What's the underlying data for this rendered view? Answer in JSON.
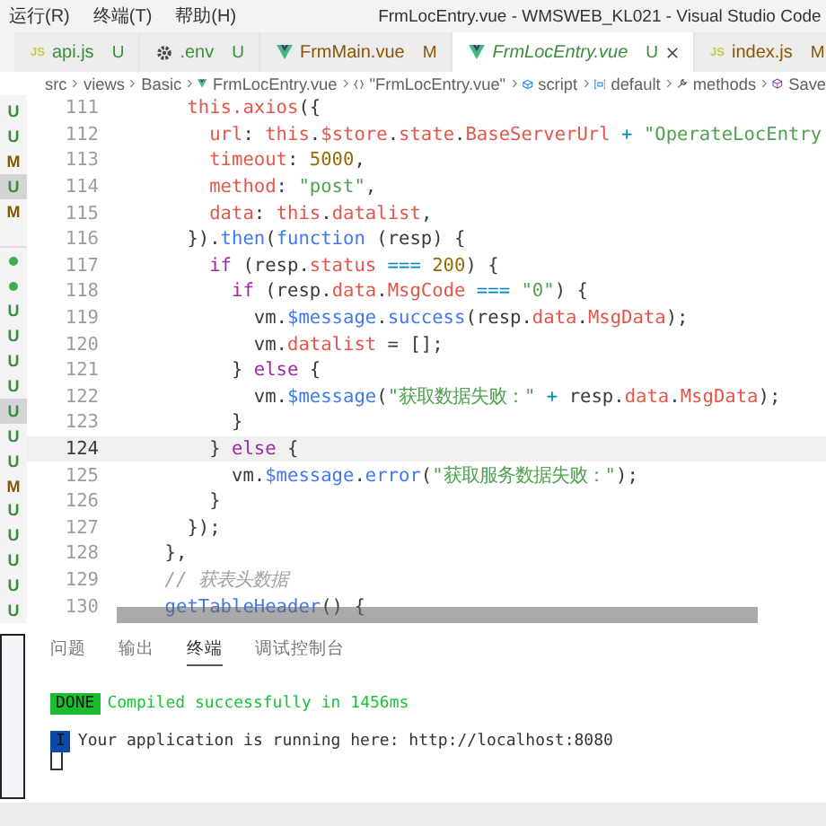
{
  "menu": {
    "items": [
      "运行(R)",
      "终端(T)",
      "帮助(H)"
    ]
  },
  "window": {
    "title": "FrmLocEntry.vue - WMSWEB_KL021 - Visual Studio Code"
  },
  "tabs": [
    {
      "label": "api.js",
      "kind": "js",
      "icon_label": "JS",
      "status": "U",
      "selected": false
    },
    {
      "label": ".env",
      "kind": "gear",
      "status": "U",
      "selected": false
    },
    {
      "label": "FrmMain.vue",
      "kind": "vue",
      "status": "M",
      "selected": false
    },
    {
      "label": "FrmLocEntry.vue",
      "kind": "vue",
      "status": "U",
      "selected": true
    },
    {
      "label": "index.js",
      "kind": "js",
      "icon_label": "JS",
      "status": "M",
      "selected": false
    }
  ],
  "breadcrumb": [
    {
      "label": "src",
      "kind": "plain"
    },
    {
      "label": "views",
      "kind": "plain"
    },
    {
      "label": "Basic",
      "kind": "plain"
    },
    {
      "label": "FrmLocEntry.vue",
      "kind": "vue"
    },
    {
      "label": "\"FrmLocEntry.vue\"",
      "kind": "braces"
    },
    {
      "label": "script",
      "kind": "cube"
    },
    {
      "label": "default",
      "kind": "variable"
    },
    {
      "label": "methods",
      "kind": "wrench"
    },
    {
      "label": "Save",
      "kind": "box"
    }
  ],
  "explorer_decorations": [
    {
      "kind": "letter",
      "text": "U",
      "selected": false
    },
    {
      "kind": "letter",
      "text": "U",
      "selected": false
    },
    {
      "kind": "letter",
      "text": "M",
      "selected": false
    },
    {
      "kind": "letter",
      "text": "U",
      "selected": true
    },
    {
      "kind": "letter",
      "text": "M",
      "selected": false
    },
    {
      "kind": "separator"
    },
    {
      "kind": "dot"
    },
    {
      "kind": "dot"
    },
    {
      "kind": "letter",
      "text": "U",
      "selected": false
    },
    {
      "kind": "letter",
      "text": "U",
      "selected": false
    },
    {
      "kind": "letter",
      "text": "U",
      "selected": false
    },
    {
      "kind": "letter",
      "text": "U",
      "selected": false
    },
    {
      "kind": "letter",
      "text": "U",
      "selected": true
    },
    {
      "kind": "letter",
      "text": "U",
      "selected": false
    },
    {
      "kind": "letter",
      "text": "U",
      "selected": false
    },
    {
      "kind": "letter",
      "text": "M",
      "selected": false
    },
    {
      "kind": "letter",
      "text": "U",
      "selected": false
    },
    {
      "kind": "letter",
      "text": "U",
      "selected": false
    },
    {
      "kind": "letter",
      "text": "U",
      "selected": false
    },
    {
      "kind": "letter",
      "text": "U",
      "selected": false
    },
    {
      "kind": "letter",
      "text": "U",
      "selected": false
    }
  ],
  "code": [
    {
      "number": "111",
      "current": false,
      "tokens": [
        {
          "kind": "var",
          "text": "      this.axios"
        },
        {
          "kind": "p",
          "text": "({"
        }
      ]
    },
    {
      "number": "112",
      "current": false,
      "tokens": [
        {
          "kind": "var",
          "text": "        url"
        },
        {
          "kind": "p",
          "text": ": "
        },
        {
          "kind": "var",
          "text": "this"
        },
        {
          "kind": "p",
          "text": "."
        },
        {
          "kind": "var",
          "text": "$store"
        },
        {
          "kind": "p",
          "text": "."
        },
        {
          "kind": "var",
          "text": "state"
        },
        {
          "kind": "p",
          "text": "."
        },
        {
          "kind": "var",
          "text": "BaseServerUrl"
        },
        {
          "kind": "op",
          "text": " + "
        },
        {
          "kind": "str",
          "text": "\"OperateLocEntry"
        }
      ]
    },
    {
      "number": "113",
      "current": false,
      "tokens": [
        {
          "kind": "var",
          "text": "        timeout"
        },
        {
          "kind": "p",
          "text": ": "
        },
        {
          "kind": "num",
          "text": "5000"
        },
        {
          "kind": "p",
          "text": ","
        }
      ]
    },
    {
      "number": "114",
      "current": false,
      "tokens": [
        {
          "kind": "var",
          "text": "        method"
        },
        {
          "kind": "p",
          "text": ": "
        },
        {
          "kind": "str",
          "text": "\"post\""
        },
        {
          "kind": "p",
          "text": ","
        }
      ]
    },
    {
      "number": "115",
      "current": false,
      "tokens": [
        {
          "kind": "var",
          "text": "        data"
        },
        {
          "kind": "p",
          "text": ": "
        },
        {
          "kind": "var",
          "text": "this"
        },
        {
          "kind": "p",
          "text": "."
        },
        {
          "kind": "var",
          "text": "datalist"
        },
        {
          "kind": "p",
          "text": ","
        }
      ]
    },
    {
      "number": "116",
      "current": false,
      "tokens": [
        {
          "kind": "p",
          "text": "      })."
        },
        {
          "kind": "fn",
          "text": "then"
        },
        {
          "kind": "p",
          "text": "("
        },
        {
          "kind": "fn",
          "text": "function"
        },
        {
          "kind": "p",
          "text": " (resp) {"
        }
      ]
    },
    {
      "number": "117",
      "current": false,
      "tokens": [
        {
          "kind": "kw",
          "text": "        if"
        },
        {
          "kind": "p",
          "text": " (resp."
        },
        {
          "kind": "var",
          "text": "status"
        },
        {
          "kind": "op",
          "text": " === "
        },
        {
          "kind": "num",
          "text": "200"
        },
        {
          "kind": "p",
          "text": ") {"
        }
      ]
    },
    {
      "number": "118",
      "current": false,
      "tokens": [
        {
          "kind": "kw",
          "text": "          if"
        },
        {
          "kind": "p",
          "text": " (resp."
        },
        {
          "kind": "var",
          "text": "data"
        },
        {
          "kind": "p",
          "text": "."
        },
        {
          "kind": "var",
          "text": "MsgCode"
        },
        {
          "kind": "op",
          "text": " === "
        },
        {
          "kind": "str",
          "text": "\"0\""
        },
        {
          "kind": "p",
          "text": ") {"
        }
      ]
    },
    {
      "number": "119",
      "current": false,
      "tokens": [
        {
          "kind": "p",
          "text": "            vm."
        },
        {
          "kind": "fn",
          "text": "$message"
        },
        {
          "kind": "p",
          "text": "."
        },
        {
          "kind": "fn",
          "text": "success"
        },
        {
          "kind": "p",
          "text": "(resp."
        },
        {
          "kind": "var",
          "text": "data"
        },
        {
          "kind": "p",
          "text": "."
        },
        {
          "kind": "var",
          "text": "MsgData"
        },
        {
          "kind": "p",
          "text": ");"
        }
      ]
    },
    {
      "number": "120",
      "current": false,
      "tokens": [
        {
          "kind": "p",
          "text": "            vm."
        },
        {
          "kind": "var",
          "text": "datalist"
        },
        {
          "kind": "p",
          "text": " = [];"
        }
      ]
    },
    {
      "number": "121",
      "current": false,
      "tokens": [
        {
          "kind": "p",
          "text": "          } "
        },
        {
          "kind": "kw",
          "text": "else"
        },
        {
          "kind": "p",
          "text": " {"
        }
      ]
    },
    {
      "number": "122",
      "current": false,
      "tokens": [
        {
          "kind": "p",
          "text": "            vm."
        },
        {
          "kind": "fn",
          "text": "$message"
        },
        {
          "kind": "p",
          "text": "("
        },
        {
          "kind": "str",
          "text": "\"获取数据失败：\""
        },
        {
          "kind": "op",
          "text": " + "
        },
        {
          "kind": "p",
          "text": "resp."
        },
        {
          "kind": "var",
          "text": "data"
        },
        {
          "kind": "p",
          "text": "."
        },
        {
          "kind": "var",
          "text": "MsgData"
        },
        {
          "kind": "p",
          "text": ");"
        }
      ]
    },
    {
      "number": "123",
      "current": false,
      "tokens": [
        {
          "kind": "p",
          "text": "          }"
        }
      ]
    },
    {
      "number": "124",
      "current": true,
      "tokens": [
        {
          "kind": "p",
          "text": "        } "
        },
        {
          "kind": "kw",
          "text": "else"
        },
        {
          "kind": "p",
          "text": " {"
        }
      ]
    },
    {
      "number": "125",
      "current": false,
      "tokens": [
        {
          "kind": "p",
          "text": "          vm."
        },
        {
          "kind": "fn",
          "text": "$message"
        },
        {
          "kind": "p",
          "text": "."
        },
        {
          "kind": "fn",
          "text": "error"
        },
        {
          "kind": "p",
          "text": "("
        },
        {
          "kind": "str",
          "text": "\"获取服务数据失败：\""
        },
        {
          "kind": "p",
          "text": ");"
        }
      ]
    },
    {
      "number": "126",
      "current": false,
      "tokens": [
        {
          "kind": "p",
          "text": "        }"
        }
      ]
    },
    {
      "number": "127",
      "current": false,
      "tokens": [
        {
          "kind": "p",
          "text": "      });"
        }
      ]
    },
    {
      "number": "128",
      "current": false,
      "tokens": [
        {
          "kind": "p",
          "text": "    },"
        }
      ]
    },
    {
      "number": "129",
      "current": false,
      "tokens": [
        {
          "kind": "cm",
          "text": "    // 获表头数据"
        }
      ]
    },
    {
      "number": "130",
      "current": false,
      "tokens": [
        {
          "kind": "fn",
          "text": "    getTableHeader"
        },
        {
          "kind": "p",
          "text": "() {"
        }
      ]
    }
  ],
  "panel": {
    "tabs": [
      {
        "label": "问题",
        "selected": false
      },
      {
        "label": "输出",
        "selected": false
      },
      {
        "label": "终端",
        "selected": true
      },
      {
        "label": "调试控制台",
        "selected": false
      }
    ],
    "terminal": {
      "lines": [
        {
          "kind": "done",
          "badge": "DONE",
          "text": "Compiled successfully in 1456ms"
        },
        {
          "kind": "info",
          "badge": "I",
          "text": "Your application is running here: http://localhost:8080"
        }
      ],
      "cursor": true
    }
  }
}
